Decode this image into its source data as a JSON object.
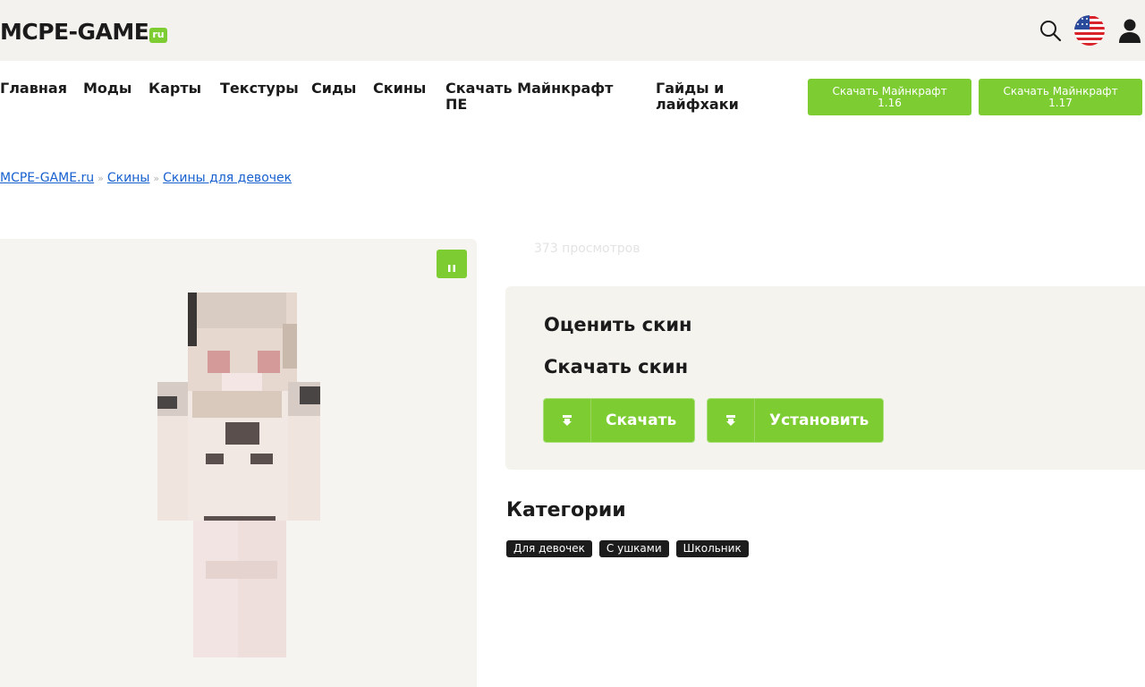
{
  "header": {
    "logo_text": "MCPE-GAME",
    "logo_suffix": "ru",
    "icons": [
      "search-icon",
      "us-flag-icon",
      "user-icon"
    ]
  },
  "nav": {
    "items": [
      {
        "label": "Главная"
      },
      {
        "label": "Моды"
      },
      {
        "label": "Карты"
      },
      {
        "label": "Текстуры"
      },
      {
        "label": "Сиды"
      },
      {
        "label": "Скины"
      },
      {
        "label_line1": "Скачать Майнкрафт",
        "label_line2": "ПЕ"
      },
      {
        "label_line1": "Гайды и",
        "label_line2": "лайфхаки"
      }
    ],
    "buttons": [
      {
        "line1": "Скачать Майнкрафт",
        "line2": "1.16"
      },
      {
        "line1": "Скачать Майнкрафт",
        "line2": "1.17"
      }
    ]
  },
  "breadcrumb": {
    "items": [
      "MCPE-GAME.ru",
      "Скины",
      "Скины для девочек"
    ],
    "separator": "»"
  },
  "skin": {
    "views": "373 просмотров"
  },
  "rating": {
    "rate_title": "Оценить скин",
    "download_title": "Скачать скин",
    "download_button": "Скачать",
    "install_button": "Установить"
  },
  "categories": {
    "title": "Категории",
    "tags": [
      "Для девочек",
      "С ушками",
      "Школьник"
    ]
  },
  "colors": {
    "accent": "#7ccc32",
    "link": "#1760cf",
    "tag_bg": "#1c1c1c"
  }
}
